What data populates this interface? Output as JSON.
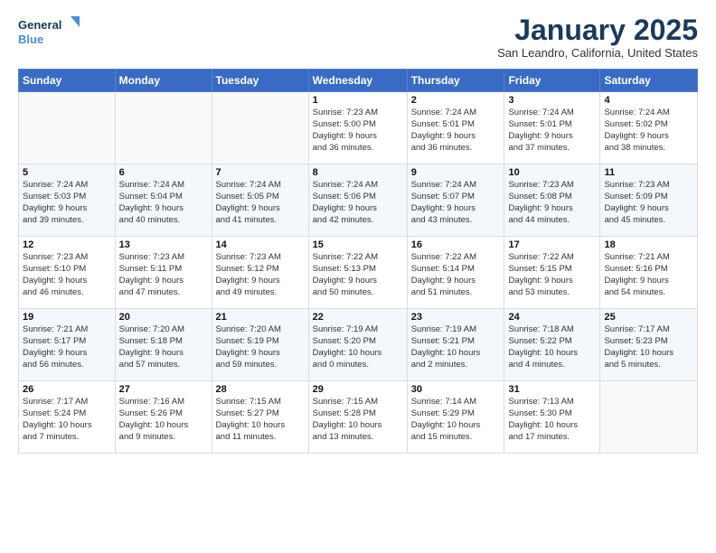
{
  "header": {
    "logo_line1": "General",
    "logo_line2": "Blue",
    "month": "January 2025",
    "location": "San Leandro, California, United States"
  },
  "weekdays": [
    "Sunday",
    "Monday",
    "Tuesday",
    "Wednesday",
    "Thursday",
    "Friday",
    "Saturday"
  ],
  "weeks": [
    [
      {
        "day": "",
        "info": ""
      },
      {
        "day": "",
        "info": ""
      },
      {
        "day": "",
        "info": ""
      },
      {
        "day": "1",
        "info": "Sunrise: 7:23 AM\nSunset: 5:00 PM\nDaylight: 9 hours\nand 36 minutes."
      },
      {
        "day": "2",
        "info": "Sunrise: 7:24 AM\nSunset: 5:01 PM\nDaylight: 9 hours\nand 36 minutes."
      },
      {
        "day": "3",
        "info": "Sunrise: 7:24 AM\nSunset: 5:01 PM\nDaylight: 9 hours\nand 37 minutes."
      },
      {
        "day": "4",
        "info": "Sunrise: 7:24 AM\nSunset: 5:02 PM\nDaylight: 9 hours\nand 38 minutes."
      }
    ],
    [
      {
        "day": "5",
        "info": "Sunrise: 7:24 AM\nSunset: 5:03 PM\nDaylight: 9 hours\nand 39 minutes."
      },
      {
        "day": "6",
        "info": "Sunrise: 7:24 AM\nSunset: 5:04 PM\nDaylight: 9 hours\nand 40 minutes."
      },
      {
        "day": "7",
        "info": "Sunrise: 7:24 AM\nSunset: 5:05 PM\nDaylight: 9 hours\nand 41 minutes."
      },
      {
        "day": "8",
        "info": "Sunrise: 7:24 AM\nSunset: 5:06 PM\nDaylight: 9 hours\nand 42 minutes."
      },
      {
        "day": "9",
        "info": "Sunrise: 7:24 AM\nSunset: 5:07 PM\nDaylight: 9 hours\nand 43 minutes."
      },
      {
        "day": "10",
        "info": "Sunrise: 7:23 AM\nSunset: 5:08 PM\nDaylight: 9 hours\nand 44 minutes."
      },
      {
        "day": "11",
        "info": "Sunrise: 7:23 AM\nSunset: 5:09 PM\nDaylight: 9 hours\nand 45 minutes."
      }
    ],
    [
      {
        "day": "12",
        "info": "Sunrise: 7:23 AM\nSunset: 5:10 PM\nDaylight: 9 hours\nand 46 minutes."
      },
      {
        "day": "13",
        "info": "Sunrise: 7:23 AM\nSunset: 5:11 PM\nDaylight: 9 hours\nand 47 minutes."
      },
      {
        "day": "14",
        "info": "Sunrise: 7:23 AM\nSunset: 5:12 PM\nDaylight: 9 hours\nand 49 minutes."
      },
      {
        "day": "15",
        "info": "Sunrise: 7:22 AM\nSunset: 5:13 PM\nDaylight: 9 hours\nand 50 minutes."
      },
      {
        "day": "16",
        "info": "Sunrise: 7:22 AM\nSunset: 5:14 PM\nDaylight: 9 hours\nand 51 minutes."
      },
      {
        "day": "17",
        "info": "Sunrise: 7:22 AM\nSunset: 5:15 PM\nDaylight: 9 hours\nand 53 minutes."
      },
      {
        "day": "18",
        "info": "Sunrise: 7:21 AM\nSunset: 5:16 PM\nDaylight: 9 hours\nand 54 minutes."
      }
    ],
    [
      {
        "day": "19",
        "info": "Sunrise: 7:21 AM\nSunset: 5:17 PM\nDaylight: 9 hours\nand 56 minutes."
      },
      {
        "day": "20",
        "info": "Sunrise: 7:20 AM\nSunset: 5:18 PM\nDaylight: 9 hours\nand 57 minutes."
      },
      {
        "day": "21",
        "info": "Sunrise: 7:20 AM\nSunset: 5:19 PM\nDaylight: 9 hours\nand 59 minutes."
      },
      {
        "day": "22",
        "info": "Sunrise: 7:19 AM\nSunset: 5:20 PM\nDaylight: 10 hours\nand 0 minutes."
      },
      {
        "day": "23",
        "info": "Sunrise: 7:19 AM\nSunset: 5:21 PM\nDaylight: 10 hours\nand 2 minutes."
      },
      {
        "day": "24",
        "info": "Sunrise: 7:18 AM\nSunset: 5:22 PM\nDaylight: 10 hours\nand 4 minutes."
      },
      {
        "day": "25",
        "info": "Sunrise: 7:17 AM\nSunset: 5:23 PM\nDaylight: 10 hours\nand 5 minutes."
      }
    ],
    [
      {
        "day": "26",
        "info": "Sunrise: 7:17 AM\nSunset: 5:24 PM\nDaylight: 10 hours\nand 7 minutes."
      },
      {
        "day": "27",
        "info": "Sunrise: 7:16 AM\nSunset: 5:26 PM\nDaylight: 10 hours\nand 9 minutes."
      },
      {
        "day": "28",
        "info": "Sunrise: 7:15 AM\nSunset: 5:27 PM\nDaylight: 10 hours\nand 11 minutes."
      },
      {
        "day": "29",
        "info": "Sunrise: 7:15 AM\nSunset: 5:28 PM\nDaylight: 10 hours\nand 13 minutes."
      },
      {
        "day": "30",
        "info": "Sunrise: 7:14 AM\nSunset: 5:29 PM\nDaylight: 10 hours\nand 15 minutes."
      },
      {
        "day": "31",
        "info": "Sunrise: 7:13 AM\nSunset: 5:30 PM\nDaylight: 10 hours\nand 17 minutes."
      },
      {
        "day": "",
        "info": ""
      }
    ]
  ]
}
